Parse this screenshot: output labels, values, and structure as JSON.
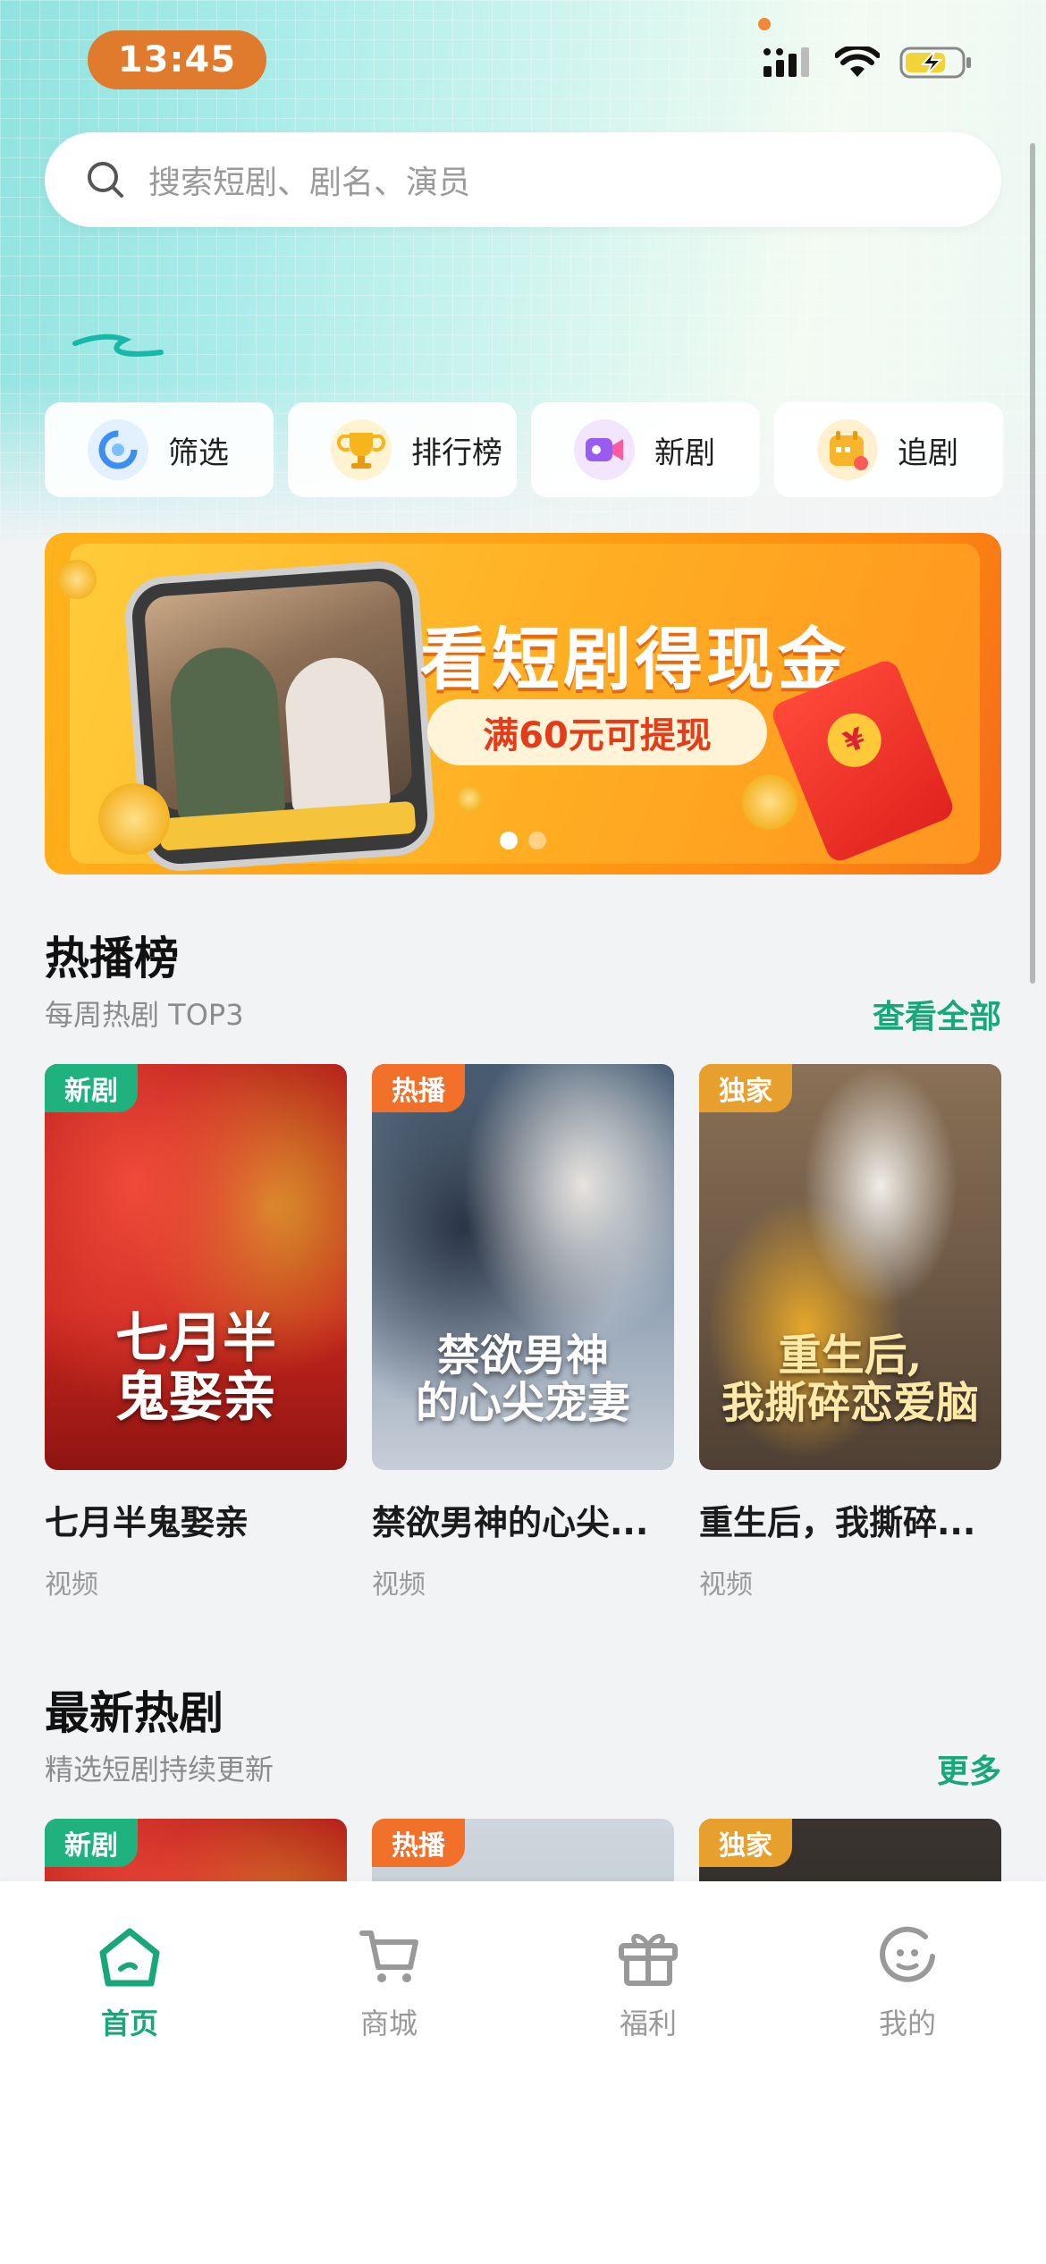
{
  "status": {
    "time": "13:45"
  },
  "search": {
    "placeholder": "搜索短剧、剧名、演员"
  },
  "quick": [
    {
      "label": "筛选",
      "icon": "filter-icon"
    },
    {
      "label": "排行榜",
      "icon": "trophy-icon"
    },
    {
      "label": "新剧",
      "icon": "video-camera-icon"
    },
    {
      "label": "追剧",
      "icon": "calendar-icon"
    }
  ],
  "banner": {
    "title": "看短剧得现金",
    "pill": "满60元可提现",
    "coin_symbol": "¥",
    "slide_count": 2,
    "active_slide": 1
  },
  "hot": {
    "title": "热播榜",
    "subtitle": "每周热剧 TOP3",
    "more": "查看全部",
    "items": [
      {
        "tag": "新剧",
        "poster_text": "七月半\n鬼娶亲",
        "title": "七月半鬼娶亲",
        "type": "视频",
        "tag_color": "#1fb27f"
      },
      {
        "tag": "热播",
        "poster_text": "禁欲男神\n的心尖宠妻",
        "title": "禁欲男神的心尖...",
        "type": "视频",
        "tag_color": "#f2712a"
      },
      {
        "tag": "独家",
        "poster_text": "重生后,\n我撕碎恋爱脑",
        "title": "重生后，我撕碎...",
        "type": "视频",
        "tag_color": "#e7a02d"
      }
    ]
  },
  "latest": {
    "title": "最新热剧",
    "subtitle": "精选短剧持续更新",
    "more": "更多",
    "items": [
      {
        "tag": "新剧",
        "tag_color": "#1fb27f"
      },
      {
        "tag": "热播",
        "tag_color": "#f2712a"
      },
      {
        "tag": "独家",
        "tag_color": "#e7a02d"
      }
    ]
  },
  "tabs": [
    {
      "label": "首页",
      "icon": "home-icon",
      "active": true
    },
    {
      "label": "商城",
      "icon": "cart-icon",
      "active": false
    },
    {
      "label": "福利",
      "icon": "gift-icon",
      "active": false
    },
    {
      "label": "我的",
      "icon": "profile-icon",
      "active": false
    }
  ],
  "colors": {
    "accent": "#17a779",
    "banner_orange": "#ffad22"
  }
}
